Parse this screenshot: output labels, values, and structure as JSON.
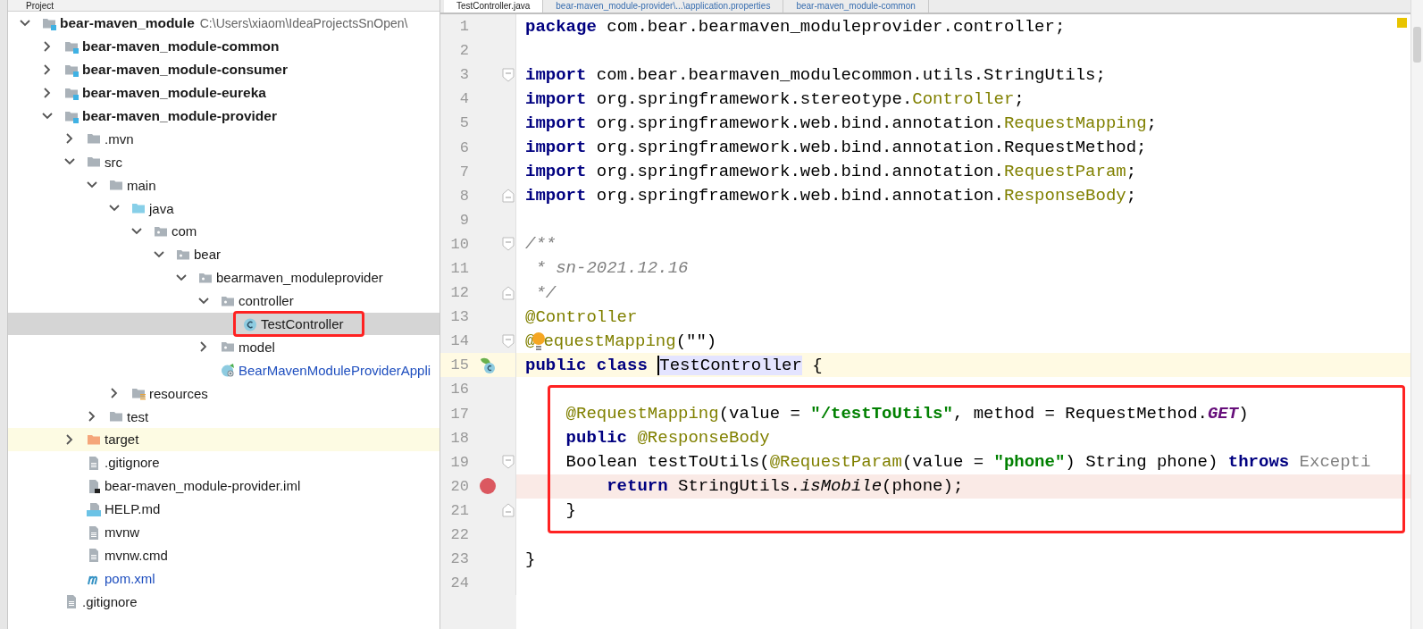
{
  "project_panel": {
    "title": "Project",
    "tree": [
      {
        "label": "bear-maven_module",
        "path": "C:\\Users\\xiaom\\IdeaProjectsSnOpen\\",
        "kind": "module",
        "expanded": true,
        "selected": false,
        "children": [
          {
            "label": "bear-maven_module-common",
            "kind": "module",
            "expanded": false,
            "selected": false
          },
          {
            "label": "bear-maven_module-consumer",
            "kind": "module",
            "expanded": false,
            "selected": false
          },
          {
            "label": "bear-maven_module-eureka",
            "kind": "module",
            "expanded": false,
            "selected": false
          },
          {
            "label": "bear-maven_module-provider",
            "kind": "module",
            "expanded": true,
            "selected": false,
            "children": [
              {
                "label": ".mvn",
                "kind": "folder",
                "expanded": false,
                "selected": false
              },
              {
                "label": "src",
                "kind": "folder",
                "expanded": true,
                "selected": false,
                "children": [
                  {
                    "label": "main",
                    "kind": "folder",
                    "expanded": true,
                    "selected": false,
                    "children": [
                      {
                        "label": "java",
                        "kind": "source",
                        "expanded": true,
                        "selected": false,
                        "children": [
                          {
                            "label": "com",
                            "kind": "package",
                            "expanded": true,
                            "selected": false,
                            "children": [
                              {
                                "label": "bear",
                                "kind": "package",
                                "expanded": true,
                                "selected": false,
                                "children": [
                                  {
                                    "label": "bearmaven_moduleprovider",
                                    "kind": "package",
                                    "expanded": true,
                                    "selected": false,
                                    "children": [
                                      {
                                        "label": "controller",
                                        "kind": "package",
                                        "expanded": true,
                                        "selected": false,
                                        "children": [
                                          {
                                            "label": "TestController",
                                            "kind": "class",
                                            "selected": true,
                                            "boxed": true
                                          }
                                        ]
                                      },
                                      {
                                        "label": "model",
                                        "kind": "package",
                                        "expanded": false,
                                        "selected": false
                                      },
                                      {
                                        "label": "BearMavenModuleProviderAppli",
                                        "kind": "application",
                                        "selected": false
                                      }
                                    ]
                                  }
                                ]
                              }
                            ]
                          }
                        ]
                      },
                      {
                        "label": "resources",
                        "kind": "resources",
                        "expanded": false,
                        "selected": false
                      }
                    ]
                  },
                  {
                    "label": "test",
                    "kind": "folder",
                    "expanded": false,
                    "selected": false
                  }
                ]
              },
              {
                "label": "target",
                "kind": "excluded",
                "expanded": false,
                "selected": false
              },
              {
                "label": ".gitignore",
                "kind": "text",
                "selected": false
              },
              {
                "label": "bear-maven_module-provider.iml",
                "kind": "iml",
                "selected": false
              },
              {
                "label": "HELP.md",
                "kind": "markdown",
                "selected": false
              },
              {
                "label": "mvnw",
                "kind": "text",
                "selected": false
              },
              {
                "label": "mvnw.cmd",
                "kind": "text",
                "selected": false
              },
              {
                "label": "pom.xml",
                "kind": "maven",
                "selected": false
              }
            ]
          },
          {
            "label": ".gitignore",
            "kind": "text",
            "selected": false
          }
        ]
      }
    ]
  },
  "editor": {
    "tabs": [
      {
        "label": "TestController.java",
        "selected": true
      },
      {
        "label": "bear-maven_module-provider\\...\\application.properties",
        "selected": false
      },
      {
        "label": "bear-maven_module-common",
        "selected": false
      }
    ],
    "blocks": [
      {
        "boxed": false,
        "lines": [
          {
            "number": "1",
            "tokens": [
              {
                "kind": "keyword",
                "text": "package"
              },
              {
                "kind": "plain",
                "text": " com.bear.bearmaven_moduleprovider.controller;"
              }
            ]
          },
          {
            "number": "2"
          },
          {
            "number": "3",
            "fold_start": true,
            "tokens": [
              {
                "kind": "keyword",
                "text": "import"
              },
              {
                "kind": "plain",
                "text": " com.bear.bearmaven_modulecommon.utils.StringUtils;"
              }
            ]
          },
          {
            "number": "4",
            "tokens": [
              {
                "kind": "keyword",
                "text": "import"
              },
              {
                "kind": "plain",
                "text": " org.springframework.stereotype."
              },
              {
                "kind": "annotation",
                "text": "Controller"
              },
              {
                "kind": "plain",
                "text": ";"
              }
            ]
          },
          {
            "number": "5",
            "tokens": [
              {
                "kind": "keyword",
                "text": "import"
              },
              {
                "kind": "plain",
                "text": " org.springframework.web.bind.annotation."
              },
              {
                "kind": "annotation",
                "text": "RequestMapping"
              },
              {
                "kind": "plain",
                "text": ";"
              }
            ]
          },
          {
            "number": "6",
            "tokens": [
              {
                "kind": "keyword",
                "text": "import"
              },
              {
                "kind": "plain",
                "text": " org.springframework.web.bind.annotation.RequestMethod;"
              }
            ]
          },
          {
            "number": "7",
            "tokens": [
              {
                "kind": "keyword",
                "text": "import"
              },
              {
                "kind": "plain",
                "text": " org.springframework.web.bind.annotation."
              },
              {
                "kind": "annotation",
                "text": "RequestParam"
              },
              {
                "kind": "plain",
                "text": ";"
              }
            ]
          },
          {
            "number": "8",
            "fold_end": true,
            "tokens": [
              {
                "kind": "keyword",
                "text": "import"
              },
              {
                "kind": "plain",
                "text": " org.springframework.web.bind.annotation."
              },
              {
                "kind": "annotation",
                "text": "ResponseBody"
              },
              {
                "kind": "plain",
                "text": ";"
              }
            ]
          },
          {
            "number": "9"
          },
          {
            "number": "10",
            "fold_start": true,
            "tokens": [
              {
                "kind": "comment",
                "text": "/**"
              }
            ]
          },
          {
            "number": "11",
            "tokens": [
              {
                "kind": "comment",
                "text": " * sn-2021.12.16"
              }
            ]
          },
          {
            "number": "12",
            "fold_end": true,
            "tokens": [
              {
                "kind": "comment",
                "text": " */"
              }
            ]
          },
          {
            "number": "13",
            "tokens": [
              {
                "kind": "annotation",
                "text": "@Controller"
              }
            ]
          },
          {
            "number": "14",
            "fold_start": true,
            "bulb": true,
            "tokens": [
              {
                "kind": "annotation",
                "text": "@"
              },
              {
                "kind": "annotation",
                "text": "equestMapping"
              },
              {
                "kind": "plain",
                "text": "(\"\")"
              }
            ]
          },
          {
            "number": "15",
            "run_icon": true,
            "current": true,
            "caret": true,
            "tokens": [
              {
                "kind": "keyword",
                "text": "public class "
              },
              {
                "kind": "selection",
                "text": "TestController"
              },
              {
                "kind": "plain",
                "text": " {"
              }
            ]
          }
        ]
      },
      {
        "boxed": true,
        "lines": [
          {
            "number": "16"
          },
          {
            "number": "17",
            "tokens": [
              {
                "kind": "annotation",
                "text": "    @RequestMapping"
              },
              {
                "kind": "plain",
                "text": "(value = "
              },
              {
                "kind": "string",
                "text": "\"/testToUtils\""
              },
              {
                "kind": "plain",
                "text": ", method = RequestMethod."
              },
              {
                "kind": "constant",
                "text": "GET"
              },
              {
                "kind": "plain",
                "text": ")"
              }
            ]
          },
          {
            "number": "18",
            "tokens": [
              {
                "kind": "keyword",
                "text": "    public"
              },
              {
                "kind": "annotation",
                "text": " @ResponseBody"
              }
            ]
          },
          {
            "number": "19",
            "fold_start": true,
            "tokens": [
              {
                "kind": "plain",
                "text": "    Boolean testToUtils("
              },
              {
                "kind": "annotation",
                "text": "@RequestParam"
              },
              {
                "kind": "plain",
                "text": "(value = "
              },
              {
                "kind": "string",
                "text": "\"phone\""
              },
              {
                "kind": "plain",
                "text": ") String phone) "
              },
              {
                "kind": "keyword",
                "text": "throws"
              },
              {
                "kind": "unused",
                "text": " Excepti"
              }
            ]
          },
          {
            "number": "20",
            "breakpoint": true,
            "tokens": [
              {
                "kind": "keyword",
                "text": "        return"
              },
              {
                "kind": "plain",
                "text": " StringUtils."
              },
              {
                "kind": "italic",
                "text": "isMobile"
              },
              {
                "kind": "plain",
                "text": "(phone);"
              }
            ]
          },
          {
            "number": "21",
            "fold_end": true,
            "tokens": [
              {
                "kind": "plain",
                "text": "    }"
              }
            ]
          },
          {
            "number": "22"
          }
        ]
      },
      {
        "boxed": false,
        "lines": [
          {
            "number": "23",
            "tokens": [
              {
                "kind": "plain",
                "text": "}"
              }
            ]
          },
          {
            "number": "24"
          }
        ]
      }
    ]
  }
}
